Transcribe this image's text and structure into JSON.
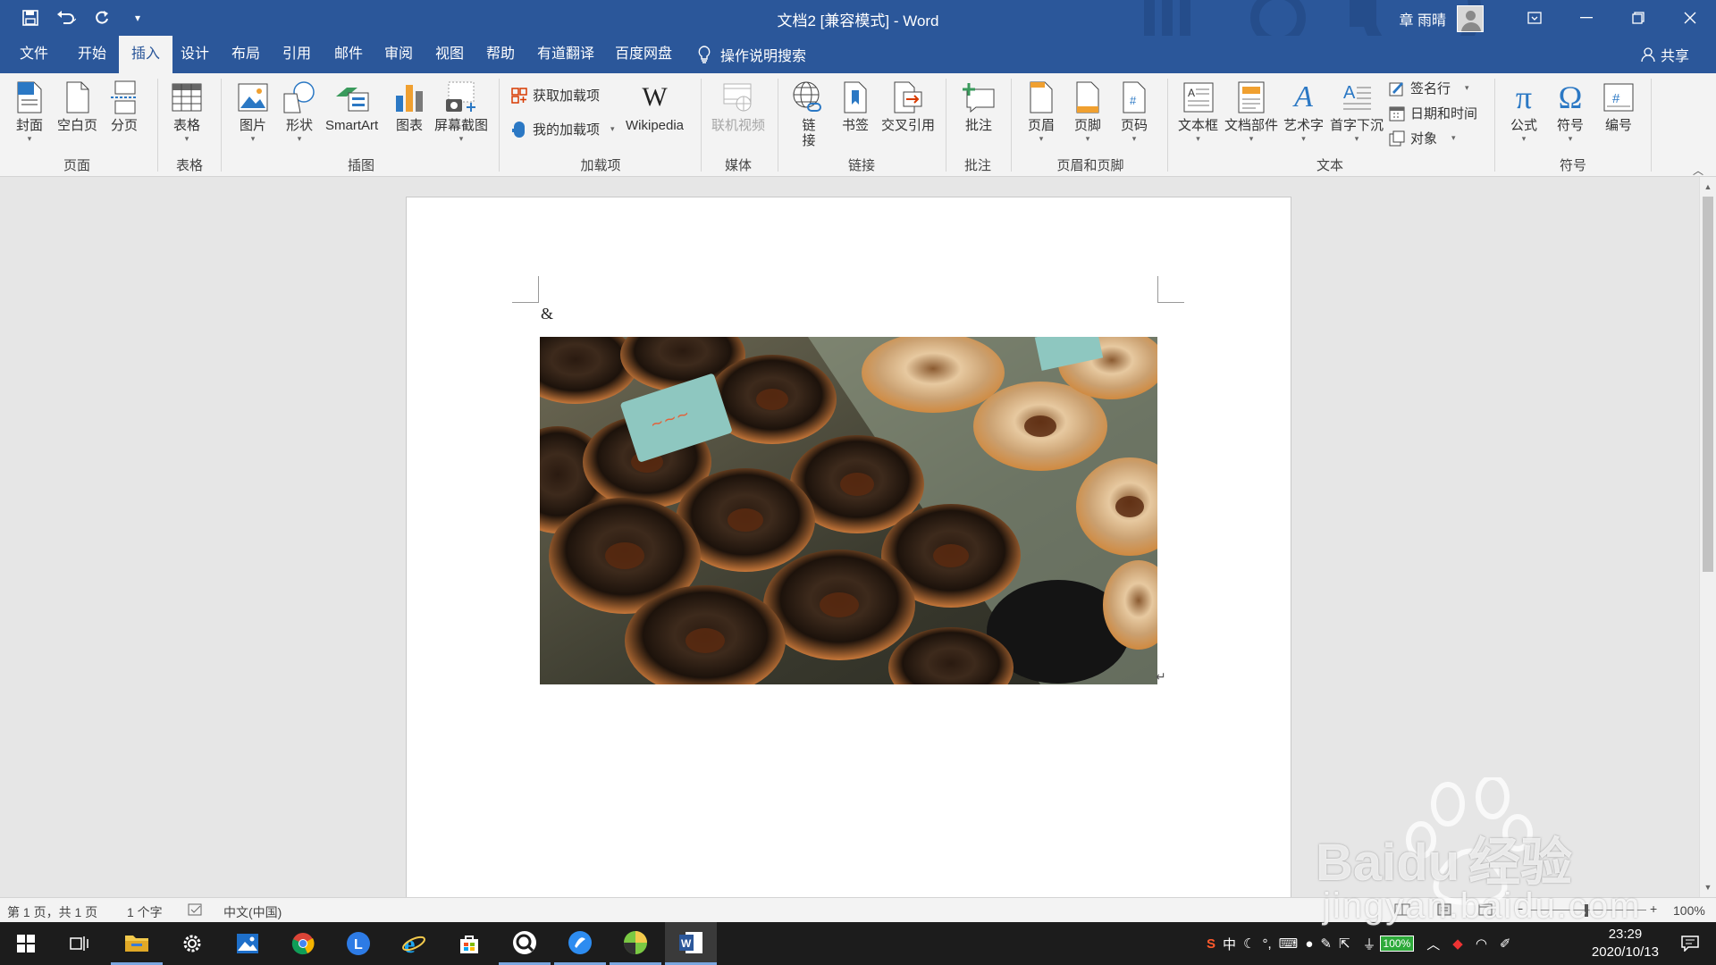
{
  "window": {
    "title": "文档2 [兼容模式]  -  Word",
    "user_name": "章 雨晴"
  },
  "tabs": [
    {
      "label": "文件"
    },
    {
      "label": "开始"
    },
    {
      "label": "插入"
    },
    {
      "label": "设计"
    },
    {
      "label": "布局"
    },
    {
      "label": "引用"
    },
    {
      "label": "邮件"
    },
    {
      "label": "审阅"
    },
    {
      "label": "视图"
    },
    {
      "label": "帮助"
    },
    {
      "label": "有道翻译"
    },
    {
      "label": "百度网盘"
    }
  ],
  "active_tab": "插入",
  "tell_me": "操作说明搜索",
  "share": "共享",
  "ribbon": {
    "pages": {
      "group": "页面",
      "cover": "封面",
      "blank": "空白页",
      "break": "分页"
    },
    "tables": {
      "group": "表格",
      "table": "表格"
    },
    "illustrations": {
      "group": "插图",
      "picture": "图片",
      "shapes": "形状",
      "smartart": "SmartArt",
      "chart": "图表",
      "screenshot": "屏幕截图"
    },
    "addins": {
      "group": "加载项",
      "get": "获取加载项",
      "mine": "我的加载项",
      "wiki": "Wikipedia"
    },
    "media": {
      "group": "媒体",
      "video": "联机视频"
    },
    "links": {
      "group": "链接",
      "link_1": "链",
      "link_2": "接",
      "bookmark": "书签",
      "crossref": "交叉引用"
    },
    "comments": {
      "group": "批注",
      "comment": "批注"
    },
    "headerfooter": {
      "group": "页眉和页脚",
      "header": "页眉",
      "footer": "页脚",
      "pagenum": "页码"
    },
    "text": {
      "group": "文本",
      "textbox": "文本框",
      "parts": "文档部件",
      "wordart": "艺术字",
      "dropcap": "首字下沉",
      "sigline": "签名行",
      "datetime": "日期和时间",
      "object": "对象"
    },
    "symbols": {
      "group": "符号",
      "equation": "公式",
      "symbol": "符号",
      "number": "编号"
    }
  },
  "document": {
    "text": "&",
    "image": "donuts-photo"
  },
  "status": {
    "page": "第 1 页，共 1 页",
    "words": "1 个字",
    "language": "中文(中国)",
    "zoom": "100%"
  },
  "taskbar": {
    "ime": "中",
    "battery": "100%",
    "time": "23:29",
    "date": "2020/10/13"
  },
  "watermark": {
    "brand": "Bai",
    "brand2": "du",
    "cn": "经验",
    "url": "jingyan.baidu.com"
  },
  "colors": {
    "accent": "#2b579a",
    "taskbar": "#1c1c1c"
  }
}
